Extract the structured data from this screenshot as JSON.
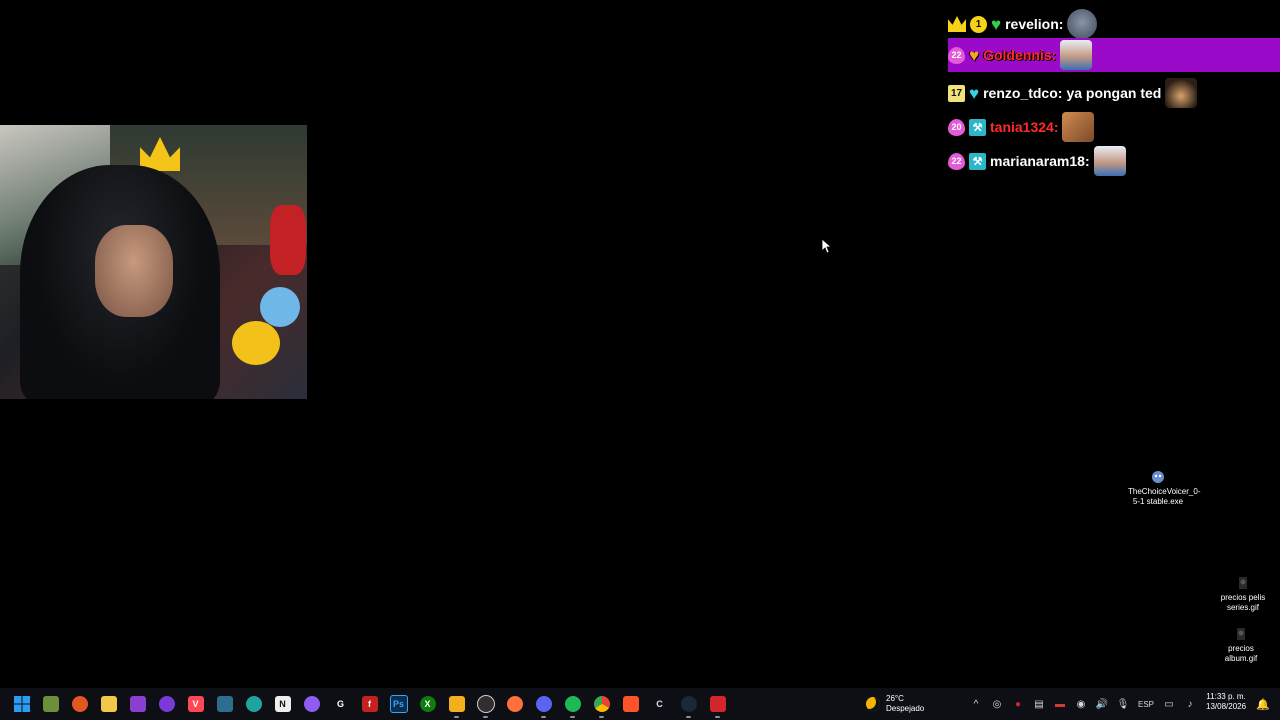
{
  "chat": {
    "messages": [
      {
        "user": "revelion:",
        "text": "",
        "user_color": "#ffffff",
        "badges": [
          "crown-badge",
          "1",
          "green-heart"
        ],
        "emote": "cat-emote"
      },
      {
        "user": "Goldennis:",
        "text": "",
        "user_color": "#ff2b2b",
        "badges": [
          "22",
          "orange-heart"
        ],
        "emote": "man-emote",
        "highlighted": true
      },
      {
        "user": "renzo_tdco:",
        "text": "ya pongan ted",
        "user_color": "#ffffff",
        "badges": [
          "17",
          "cyan-heart"
        ],
        "emote": "black-cat-emote"
      },
      {
        "user": "tania1324:",
        "text": "",
        "user_color": "#ff2b2b",
        "badges": [
          "20",
          "hammer"
        ],
        "emote": "tiger-cat-emote"
      },
      {
        "user": "marianaram18:",
        "text": "",
        "user_color": "#ffffff",
        "badges": [
          "22",
          "hammer"
        ],
        "emote": "man-emote"
      }
    ]
  },
  "desktop_icons": [
    {
      "label": "TheChoiceVoicer_0-5-1 stable.exe"
    },
    {
      "label": "precios pelis series.gif"
    },
    {
      "label": "precios album.gif"
    }
  ],
  "taskbar": {
    "weather_temp": "26°C",
    "weather_desc": "Despejado",
    "language": "ESP",
    "time": "11:33 p. m.",
    "date": "13/08/2026"
  },
  "colors": {
    "highlight": "#9b0ac8",
    "taskbar": "#0d0f14",
    "desktop": "#000000"
  }
}
